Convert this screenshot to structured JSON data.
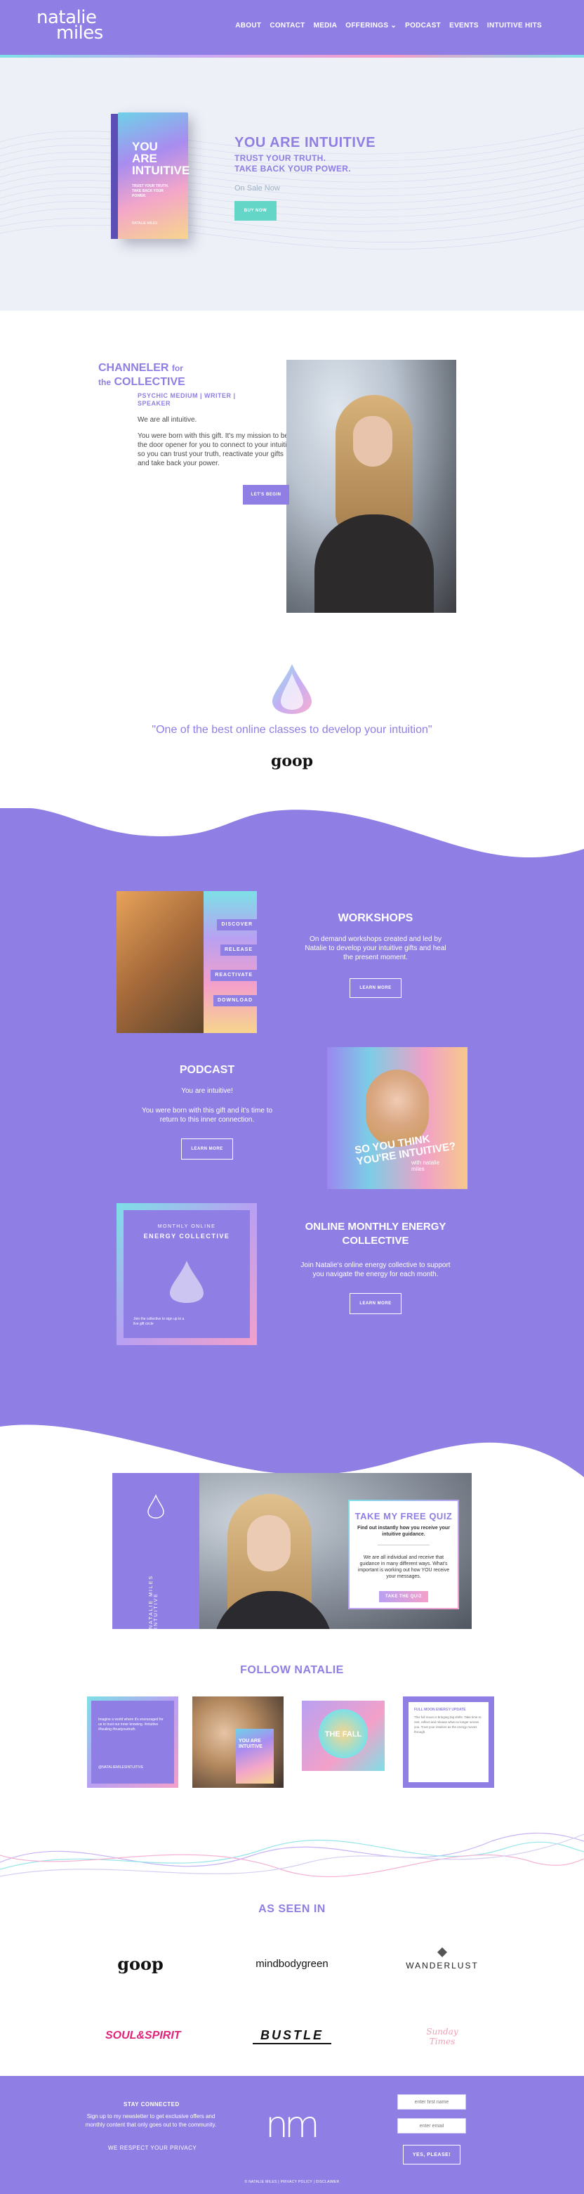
{
  "colors": {
    "brand": "#8f7ee3",
    "teal": "#63d6c8",
    "white": "#ffffff"
  },
  "header": {
    "logo_line1": "natalie",
    "logo_line2": "miles",
    "nav": [
      {
        "label": "ABOUT"
      },
      {
        "label": "CONTACT"
      },
      {
        "label": "MEDIA"
      },
      {
        "label": "OFFERINGS ⌄"
      },
      {
        "label": "PODCAST"
      },
      {
        "label": "EVENTS"
      },
      {
        "label": "INTUITIVE HITS"
      }
    ]
  },
  "hero": {
    "book_title": "YOU ARE INTUITIVE",
    "book_subtitle": "TRUST YOUR TRUTH. TAKE BACK YOUR POWER.",
    "book_author": "NATALIE MILES",
    "headline": "YOU ARE INTUITIVE",
    "tag1": "TRUST YOUR TRUTH.",
    "tag2": "TAKE BACK YOUR POWER.",
    "sale": "On Sale Now",
    "button": "BUY NOW"
  },
  "about": {
    "title_a": "CHANNELER",
    "title_b": "for",
    "title_c": "the",
    "title_d": "COLLECTIVE",
    "subtitle": "PSYCHIC MEDIUM | WRITER | SPEAKER",
    "p1": "We are all intuitive.",
    "p2": "You were born with this gift. It's my mission to be the door opener for you to connect to your intuition so you can trust your truth, reactivate your gifts and take back your power.",
    "button": "LET'S BEGIN"
  },
  "press_quote": {
    "quote": "\"One of the best online classes to develop your intuition\"",
    "source": "goop"
  },
  "workshops": {
    "title": "WORKSHOPS",
    "text": "On demand workshops created and led by Natalie to develop your intuitive gifts and heal the present moment.",
    "button": "LEARN MORE",
    "list": [
      "DISCOVER",
      "RELEASE",
      "REACTIVATE",
      "DOWNLOAD"
    ]
  },
  "podcast": {
    "title": "PODCAST",
    "text1": "You are intuitive!",
    "text2": "You were born with this gift and it's time to return to this inner connection.",
    "button": "LEARN MORE",
    "tile_text": "SO YOU THINK YOU'RE INTUITIVE?",
    "tile_brand": "with natalie miles"
  },
  "collective": {
    "title": "ONLINE MONTHLY ENERGY COLLECTIVE",
    "text": "Join Natalie's online energy collective to support you navigate the energy for each month.",
    "button": "LEARN MORE",
    "tile_t1": "MONTHLY ONLINE",
    "tile_t2": "ENERGY COLLECTIVE",
    "tile_small": "Join the collective to sign up to a live gift circle"
  },
  "quiz": {
    "vertical": "NATALIE MILES INTUITIVE",
    "title": "TAKE MY FREE QUIZ",
    "p1": "Find out instantly how you receive your intuitive guidance.",
    "p2": "We are all individual and receive that guidance in many different ways. What's important is working out how YOU receive your messages.",
    "button": "TAKE THE QUIZ"
  },
  "follow": {
    "title": "FOLLOW NATALIE",
    "post1": "Imagine a world where it's encouraged for us to trust our inner knowing. #intuitive #healing #trustyourtruth",
    "post1_handle": "@NATALIEMILESINTUITIVE",
    "post2": "YOU ARE INTUITIVE",
    "post3": "THE FALL",
    "post4_title": "FULL MOON ENERGY UPDATE",
    "post4": "This full moon is bringing big shifts. Take time to rest, reflect and release what no longer serves you. Trust your intuition as the energy moves through."
  },
  "press": {
    "title": "AS SEEN IN",
    "brands": [
      "goop",
      "mindbodygreen",
      "WANDERLUST",
      "SOUL&SPIRIT",
      "BUSTLE",
      "Sunday Times"
    ]
  },
  "footer": {
    "title": "STAY CONNECTED",
    "text": "Sign up to my newsletter to get exclusive offers and monthly content that only goes out to the community.",
    "privacy": "WE RESPECT YOUR PRIVACY",
    "logo": "nm",
    "first_name_placeholder": "enter first name",
    "email_placeholder": "enter email",
    "button": "YES, PLEASE!",
    "copyright": "© NATALIE MILES | PRIVACY POLICY | DISCLAIMER"
  }
}
